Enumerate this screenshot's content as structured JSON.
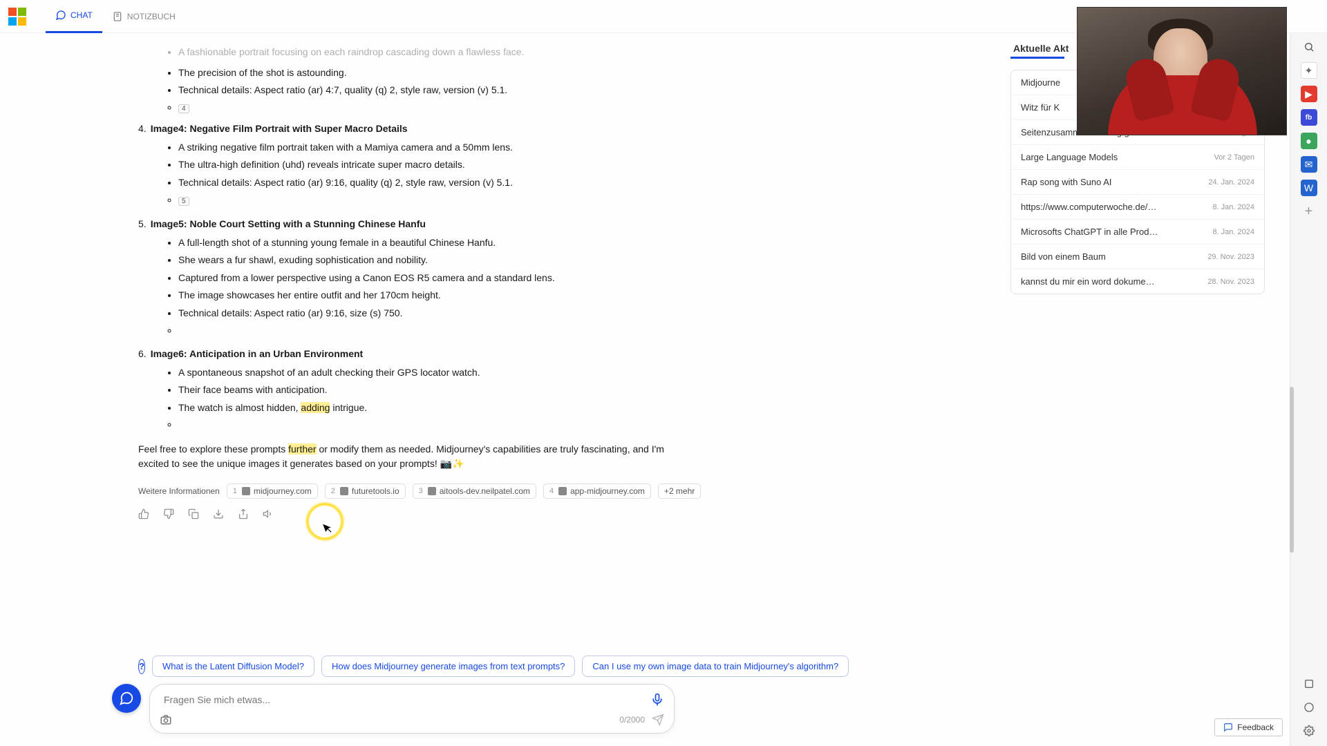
{
  "header": {
    "chat_label": "CHAT",
    "notebook_label": "NOTIZBUCH"
  },
  "content": {
    "cutoff_line": "A fashionable portrait focusing on each raindrop cascading down a flawless face.",
    "image3_extra": [
      "The precision of the shot is astounding.",
      "Technical details: Aspect ratio (ar) 4:7, quality (q) 2, style raw, version (v) 5.1."
    ],
    "image3_ref": "4",
    "items": [
      {
        "num": "4.",
        "title": "Image4: Negative Film Portrait with Super Macro Details",
        "bullets": [
          "A striking negative film portrait taken with a Mamiya camera and a 50mm lens.",
          "The ultra-high definition (uhd) reveals intricate super macro details.",
          "Technical details: Aspect ratio (ar) 9:16, quality (q) 2, style raw, version (v) 5.1."
        ],
        "ref": "5"
      },
      {
        "num": "5.",
        "title": "Image5: Noble Court Setting with a Stunning Chinese Hanfu",
        "bullets": [
          "A full-length shot of a stunning young female in a beautiful Chinese Hanfu.",
          "She wears a fur shawl, exuding sophistication and nobility.",
          "Captured from a lower perspective using a Canon EOS R5 camera and a standard lens.",
          "The image showcases her entire outfit and her 170cm height.",
          "Technical details: Aspect ratio (ar) 9:16, size (s) 750."
        ],
        "ref": ""
      },
      {
        "num": "6.",
        "title": "Image6: Anticipation in an Urban Environment",
        "bullets": [
          "A spontaneous snapshot of an adult checking their GPS locator watch.",
          "Their face beams with anticipation."
        ],
        "ref": ""
      }
    ],
    "image6_line3_a": "The watch is almost hidden, ",
    "image6_line3_hl": "adding",
    "image6_line3_b": " intrigue.",
    "closing_a": "Feel free to explore these prompts ",
    "closing_hl": "further",
    "closing_b": " or modify them as needed. Midjourney's capabilities are truly fascinating, and I'm excited to see the unique images it generates based on your prompts! 📷✨"
  },
  "sources": {
    "label": "Weitere Informationen",
    "items": [
      {
        "n": "1",
        "text": "midjourney.com"
      },
      {
        "n": "2",
        "text": "futuretools.io"
      },
      {
        "n": "3",
        "text": "aitools-dev.neilpatel.com"
      },
      {
        "n": "4",
        "text": "app-midjourney.com"
      }
    ],
    "more": "+2 mehr"
  },
  "suggestions": [
    "What is the Latent Diffusion Model?",
    "How does Midjourney generate images from text prompts?",
    "Can I use my own image data to train Midjourney's algorithm?"
  ],
  "input": {
    "placeholder": "Fragen Sie mich etwas...",
    "counter": "0/2000"
  },
  "sidebar": {
    "title": "Aktuelle Akt",
    "rows": [
      {
        "label": "Midjourne",
        "date": ""
      },
      {
        "label": "Witz für K",
        "date": ""
      },
      {
        "label": "Seitenzusammenfassung generieren",
        "date": "Vor 2 Tagen"
      },
      {
        "label": "Large Language Models",
        "date": "Vor 2 Tagen"
      },
      {
        "label": "Rap song with Suno AI",
        "date": "24. Jan. 2024"
      },
      {
        "label": "https://www.computerwoche.de/a/mi",
        "date": "8. Jan. 2024"
      },
      {
        "label": "Microsofts ChatGPT in alle Produkte in",
        "date": "8. Jan. 2024"
      },
      {
        "label": "Bild von einem Baum",
        "date": "29. Nov. 2023"
      },
      {
        "label": "kannst du mir ein word dokument ers",
        "date": "28. Nov. 2023"
      }
    ]
  },
  "feedback_btn": "Feedback"
}
